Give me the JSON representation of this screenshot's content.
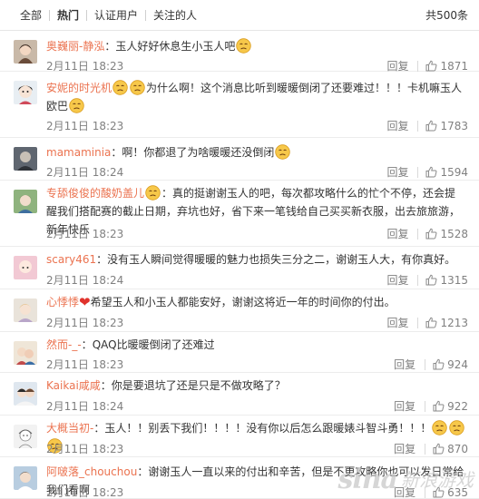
{
  "tabs": [
    {
      "label": "全部"
    },
    {
      "label": "热门"
    },
    {
      "label": "认证用户"
    },
    {
      "label": "关注的人"
    }
  ],
  "total": "共500条",
  "accent_color": "#eb7350",
  "comments": [
    {
      "user": "奥巍丽-静泓",
      "sep": "：",
      "before": "玉人好好休息生小玉人吧",
      "after": "",
      "emojis_before": 0,
      "emojis_after": 1,
      "time": "2月11日 18:23",
      "reply": "回复",
      "likes": "1871",
      "avatar": "girl"
    },
    {
      "user": "安妮的时光机",
      "sep": "",
      "before": "",
      "after": "为什么啊！这个消息比听到暖暖倒闭了还要难过！！！卡机嘛玉人欧巴",
      "emojis_before": 2,
      "emojis_after": 1,
      "time": "2月11日 18:23",
      "reply": "回复",
      "likes": "1783",
      "avatar": "anime"
    },
    {
      "user": "mamaminia",
      "sep": "：",
      "before": "啊！你都退了为啥暖暖还没倒闭",
      "after": "",
      "emojis_before": 0,
      "emojis_after": 1,
      "time": "2月11日 18:24",
      "reply": "回复",
      "likes": "1594",
      "avatar": "dark"
    },
    {
      "user": "专舔俊俊的酸奶盖儿",
      "sep": "",
      "before": "",
      "after": "：真的挺谢谢玉人的吧，每次都攻略什么的忙个不停，还会提醒我们搭配赛的截止日期，弃坑也好，省下来一笔钱给自己买买新衣服，出去旅旅游，新年快乐",
      "emojis_before": 1,
      "emojis_after": 0,
      "time": "2月11日 18:23",
      "reply": "回复",
      "likes": "1528",
      "avatar": "green"
    },
    {
      "user": "scary461",
      "sep": "：",
      "before": "没有玉人瞬间觉得暖暖的魅力也损失三分之二，谢谢玉人大，有你真好。",
      "after": "",
      "emojis_before": 0,
      "emojis_after": 0,
      "time": "2月11日 18:24",
      "reply": "回复",
      "likes": "1315",
      "avatar": "pink"
    },
    {
      "user": "心悸悸",
      "sep": "",
      "before": "",
      "after": "希望玉人和小玉人都能安好，谢谢这将近一年的时间你的付出。",
      "emojis_before": 0,
      "emojis_after": 0,
      "heart": "❤",
      "time": "2月11日 18:23",
      "reply": "回复",
      "likes": "1213",
      "avatar": "light"
    },
    {
      "user": "然而-_-",
      "sep": "：",
      "before": "QAQ比暖暖倒闭了还难过",
      "after": "",
      "emojis_before": 0,
      "emojis_after": 0,
      "time": "2月11日 18:23",
      "reply": "回复",
      "likes": "924",
      "avatar": "mixed"
    },
    {
      "user": "Kaikai咸咸",
      "sep": "：",
      "before": "你是要退坑了还是只是不做攻略了？",
      "after": "",
      "emojis_before": 0,
      "emojis_after": 0,
      "time": "2月11日 18:24",
      "reply": "回复",
      "likes": "922",
      "avatar": "couple"
    },
    {
      "user": "大概当初-",
      "sep": "：",
      "before": "玉人！！别丢下我们！！！！没有你以后怎么跟暖婊斗智斗勇！！！",
      "after": "",
      "emojis_before": 0,
      "emojis_after": 3,
      "time": "2月11日 18:23",
      "reply": "回复",
      "likes": "870",
      "avatar": "sketch"
    },
    {
      "user": "阿啵落_chouchou",
      "sep": "：",
      "before": "谢谢玉人一直以来的付出和辛苦，但是不更攻略你也可以发日常给我们看啊",
      "after": "",
      "emojis_before": 0,
      "emojis_after": 0,
      "time": "2月11日 18:23",
      "reply": "回复",
      "likes": "635",
      "avatar": "blue"
    }
  ],
  "watermark": {
    "brand": "sina",
    "text": "新浪游戏"
  }
}
